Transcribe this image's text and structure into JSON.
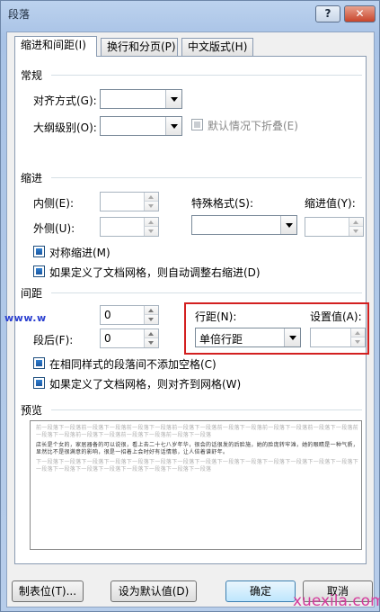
{
  "window": {
    "title": "段落",
    "help": "?",
    "close": "✕"
  },
  "tabs": [
    "缩进和间距(I)",
    "换行和分页(P)",
    "中文版式(H)"
  ],
  "general": {
    "heading": "常规",
    "alignment_label": "对齐方式(G):",
    "alignment_value": "",
    "outline_label": "大纲级别(O):",
    "outline_value": "",
    "collapsed_label": "默认情况下折叠(E)"
  },
  "indent": {
    "heading": "缩进",
    "inside_label": "内侧(E):",
    "outside_label": "外侧(U):",
    "special_label": "特殊格式(S):",
    "special_value": "",
    "by_label": "缩进值(Y):",
    "mirror_label": "对称缩进(M)",
    "auto_adjust_label": "如果定义了文档网格，则自动调整右缩进(D)"
  },
  "spacing": {
    "heading": "间距",
    "before_value": "0",
    "after_label": "段后(F):",
    "after_value": "0",
    "line_label": "行距(N):",
    "line_value": "单倍行距",
    "at_label": "设置值(A):",
    "no_space_label": "在相同样式的段落间不添加空格(C)",
    "snap_label": "如果定义了文档网格，则对齐到网格(W)"
  },
  "preview": {
    "heading": "预览",
    "prev_text": "前一段落下一段落前一段落下一段落前一段落下一段落前一段落下一段落前一段落下一段落前一段落下一段落前一段落下一段落前一段落下一段落前一段落下一段落前一段落下一段落前一段落下一段落",
    "sample_text": "店长是个女的，家居器备的可以说很，看上去二十七八岁年华，很会的话很发的后脸施，她的脸庞转牢滩，她的眼睛是一种气质，显然比不是很满意的影响，很是一招着上会时好有话情慈，让人倍着谱舒年。",
    "next_text": "下一段落下一段落下一段落下一段落下一段落下一段落下一段落下一段落下一段落下一段落下一段落下一段落下一段落下一段落下一段落下一段落下一段落下一段落下一段落下一段落下一段落下一段落"
  },
  "buttons": {
    "tabs": "制表位(T)...",
    "set_default": "设为默认值(D)",
    "ok": "确定",
    "cancel": "取消"
  },
  "watermarks": {
    "left": "www.w",
    "right": "xuexila.com"
  }
}
